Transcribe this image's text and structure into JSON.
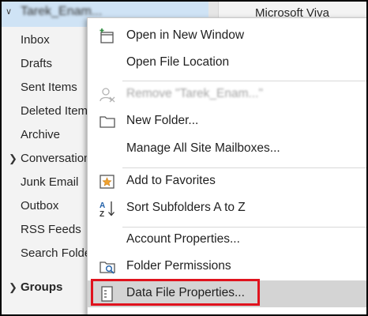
{
  "folder_pane": {
    "account_name": "Tarek_Enam...",
    "folders": [
      {
        "label": "Inbox"
      },
      {
        "label": "Drafts"
      },
      {
        "label": "Sent Items"
      },
      {
        "label": "Deleted Items"
      },
      {
        "label": "Archive"
      },
      {
        "label": "Conversation"
      },
      {
        "label": "Junk Email"
      },
      {
        "label": "Outbox"
      },
      {
        "label": "RSS Feeds"
      },
      {
        "label": "Search Folde"
      }
    ],
    "groups_label": "Groups"
  },
  "right_pane": {
    "header": "Microsoft Viva"
  },
  "context_menu": {
    "items": [
      {
        "label": "Open in New Window",
        "icon": "open-new-window-icon"
      },
      {
        "label": "Open File Location",
        "icon": "none"
      },
      {
        "label": "Remove \"Tarek_Enam...\"",
        "icon": "remove-person-icon",
        "disabled": true
      },
      {
        "label": "New Folder...",
        "icon": "folder-icon"
      },
      {
        "label": "Manage All Site Mailboxes...",
        "icon": "none"
      },
      {
        "label": "Add to Favorites",
        "icon": "star-icon"
      },
      {
        "label": "Sort Subfolders A to Z",
        "icon": "sort-az-icon"
      },
      {
        "label": "Account Properties...",
        "icon": "none"
      },
      {
        "label": "Folder Permissions",
        "icon": "folder-permissions-icon"
      },
      {
        "label": "Data File Properties...",
        "icon": "data-file-icon",
        "selected": true
      }
    ]
  },
  "colors": {
    "highlight_border": "#e0131e",
    "selected_bg": "#d4d4d4",
    "pane_bg": "#f3f3f3",
    "account_row_bg": "#cfe3f5"
  }
}
